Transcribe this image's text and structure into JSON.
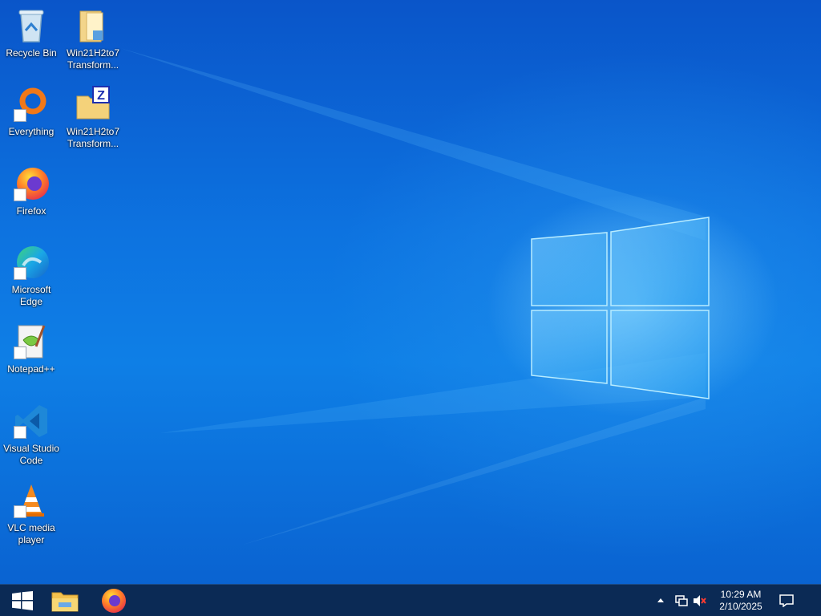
{
  "desktop": {
    "icons": [
      {
        "label": "Recycle Bin",
        "icon": "recycle-bin-icon"
      },
      {
        "label": "Win21H2to7 Transform...",
        "icon": "folder-icon"
      },
      {
        "label": "Everything",
        "icon": "everything-icon"
      },
      {
        "label": "Win21H2to7 Transform...",
        "icon": "zip-folder-icon"
      },
      {
        "label": "Firefox",
        "icon": "firefox-icon"
      },
      {
        "label": "Microsoft Edge",
        "icon": "edge-icon"
      },
      {
        "label": "Notepad++",
        "icon": "notepadpp-icon"
      },
      {
        "label": "Visual Studio Code",
        "icon": "vscode-icon"
      },
      {
        "label": "VLC media player",
        "icon": "vlc-icon"
      }
    ]
  },
  "taskbar": {
    "pinned": [
      {
        "icon": "start-icon"
      },
      {
        "icon": "file-explorer-icon"
      },
      {
        "icon": "firefox-icon"
      }
    ],
    "tray": {
      "chevron": "show-hidden-icons",
      "network": "network-icon",
      "volume": "volume-muted-icon",
      "time": "10:29 AM",
      "date": "2/10/2025",
      "notifications": "action-center-icon"
    }
  },
  "colors": {
    "taskbar": "#0b2a55",
    "desktop_base": "#0e7fe6",
    "logo_glow": "#a8e6ff"
  }
}
